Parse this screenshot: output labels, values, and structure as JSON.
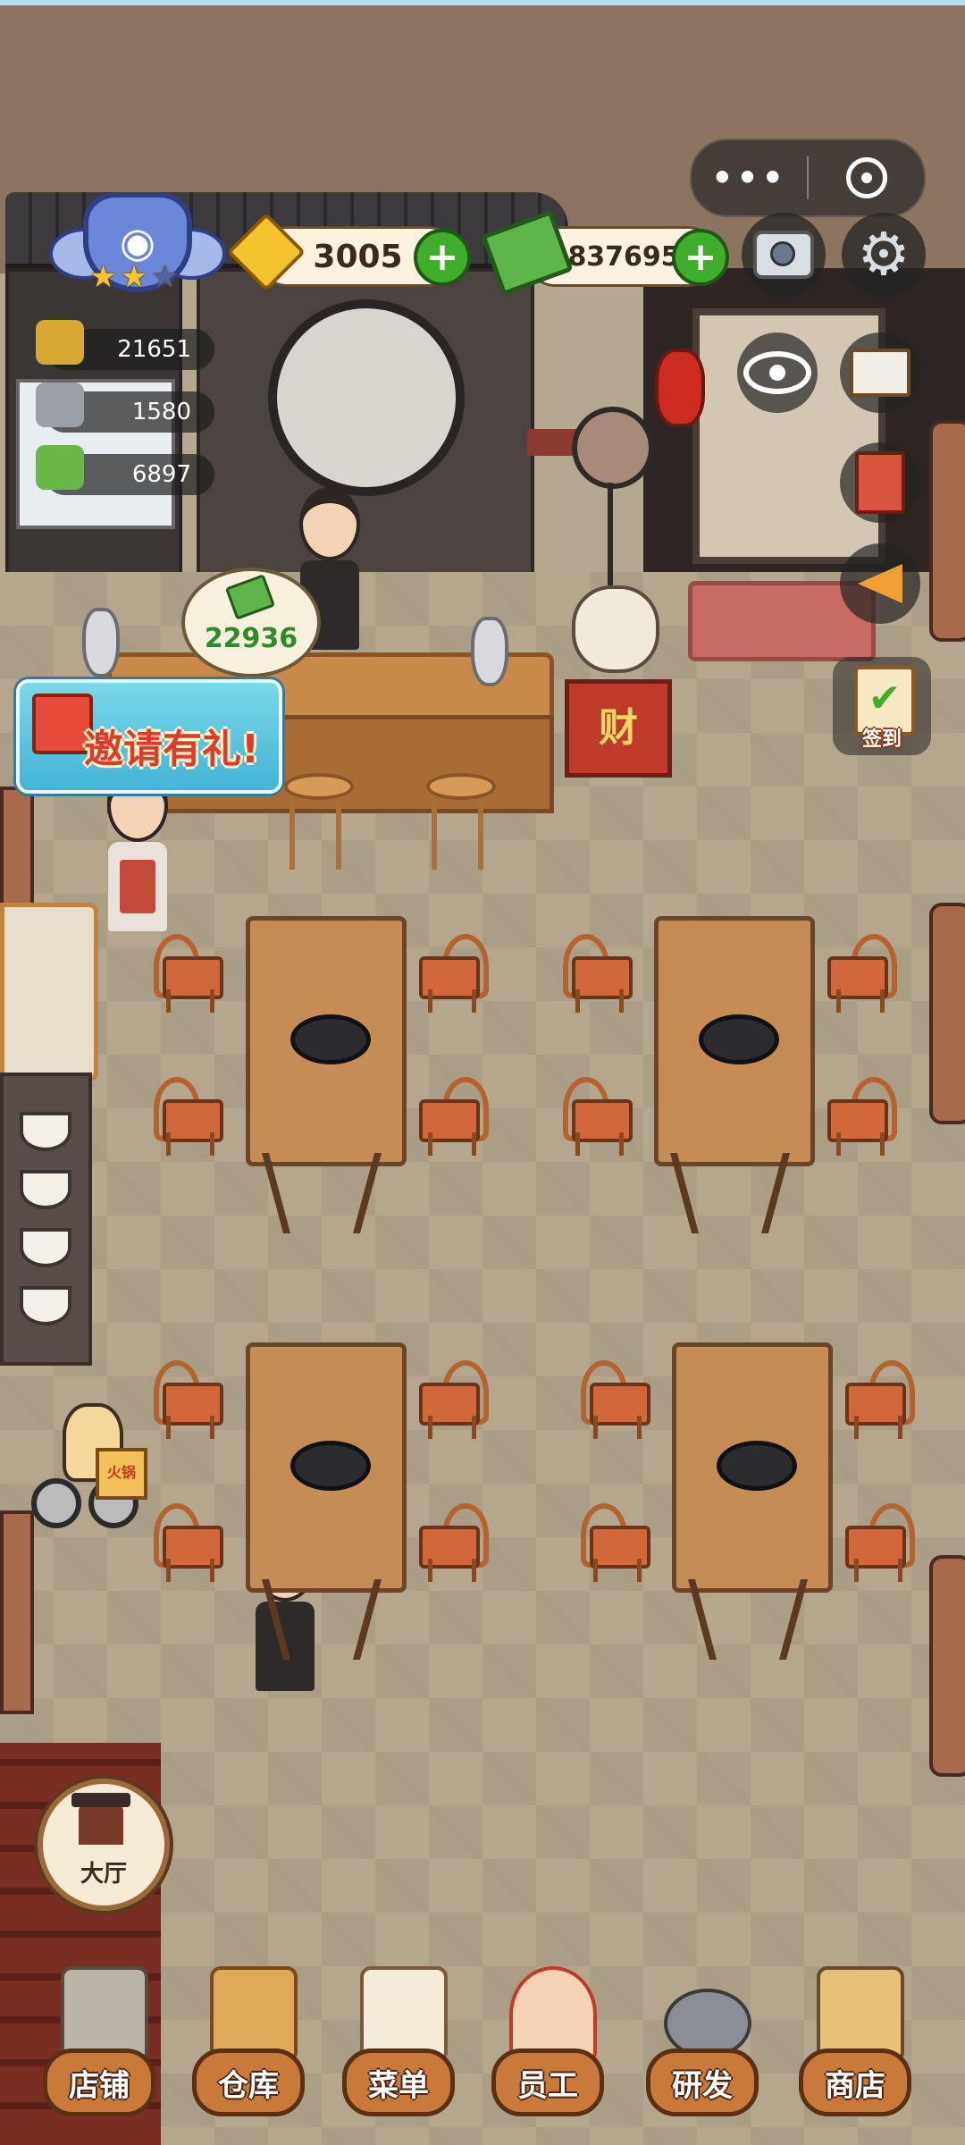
{
  "hud": {
    "gold": "3005",
    "cash": "8376950",
    "stats": [
      "21651",
      "1580",
      "6897"
    ],
    "rating": {
      "stars_filled": 2,
      "stars_total": 3
    }
  },
  "counter_bubble": {
    "value": "22936"
  },
  "signs": {
    "cat_stand": "财",
    "delivery_box": "火锅"
  },
  "buttons": {
    "invite_label": "邀请有礼!",
    "checkin_label": "签到",
    "hall_label": "大厅"
  },
  "nav": [
    {
      "label": "店铺",
      "icon": "shop-building-icon"
    },
    {
      "label": "仓库",
      "icon": "boxes-icon"
    },
    {
      "label": "菜单",
      "icon": "clipboard-menu-icon"
    },
    {
      "label": "员工",
      "icon": "staff-girl-icon"
    },
    {
      "label": "研发",
      "icon": "wok-icon"
    },
    {
      "label": "商店",
      "icon": "store-icon"
    }
  ],
  "colors": {
    "plus_green": "#3fae2d",
    "pill_bg": "#fbf3e0",
    "nav_plate": "#c97a3a"
  }
}
